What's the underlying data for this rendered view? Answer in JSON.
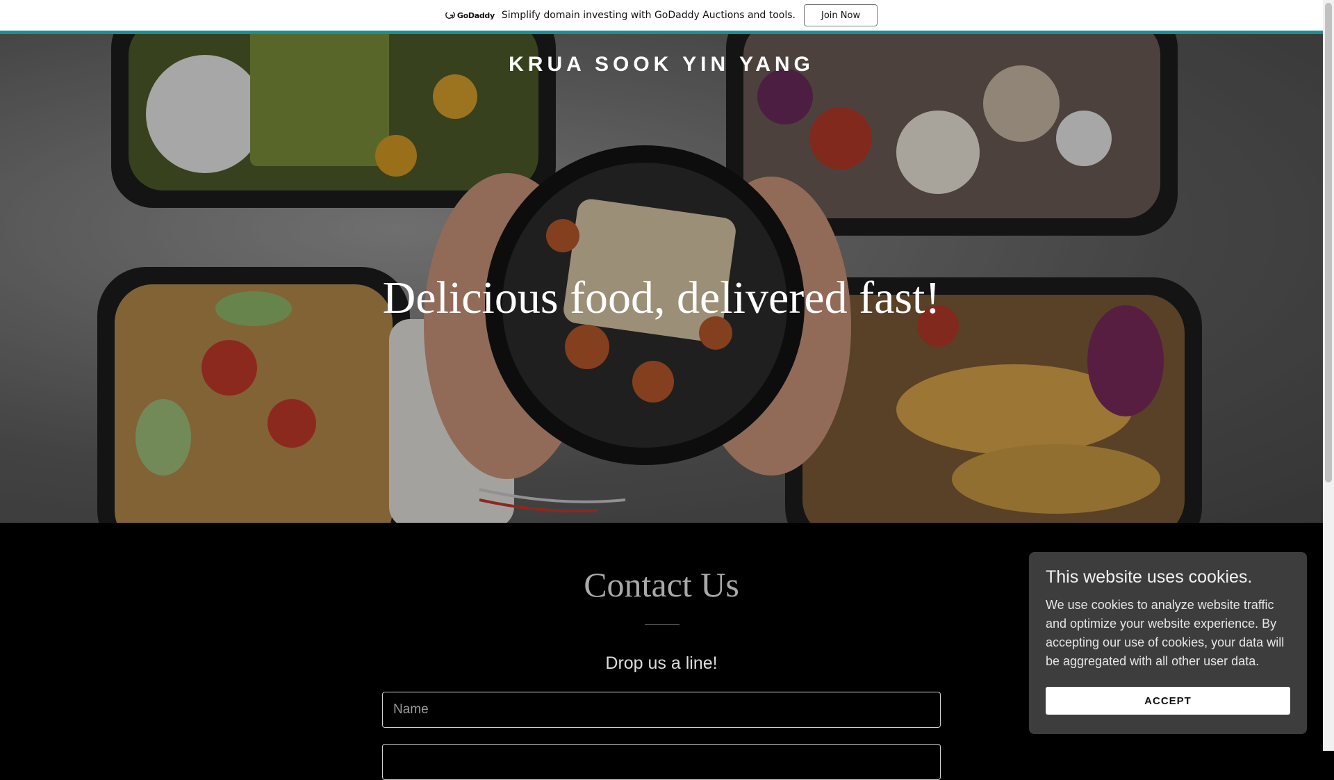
{
  "promo": {
    "logo_text": "GoDaddy",
    "message": "Simplify domain investing with GoDaddy Auctions and tools.",
    "join_label": "Join Now"
  },
  "hero": {
    "brand": "KRUA SOOK YIN YANG",
    "title": "Delicious food, delivered fast!"
  },
  "contact": {
    "heading": "Contact Us",
    "subheading": "Drop us a line!",
    "name_placeholder": "Name",
    "email_placeholder": ""
  },
  "cookie": {
    "title": "This website uses cookies.",
    "body": "We use cookies to analyze website traffic and optimize your website experience. By accepting our use of cookies, your data will be aggregated with all other user data.",
    "accept_label": "ACCEPT"
  },
  "colors": {
    "accent": "#1a8f96",
    "popup_bg": "#3d3d3d",
    "section_bg": "#000000"
  }
}
